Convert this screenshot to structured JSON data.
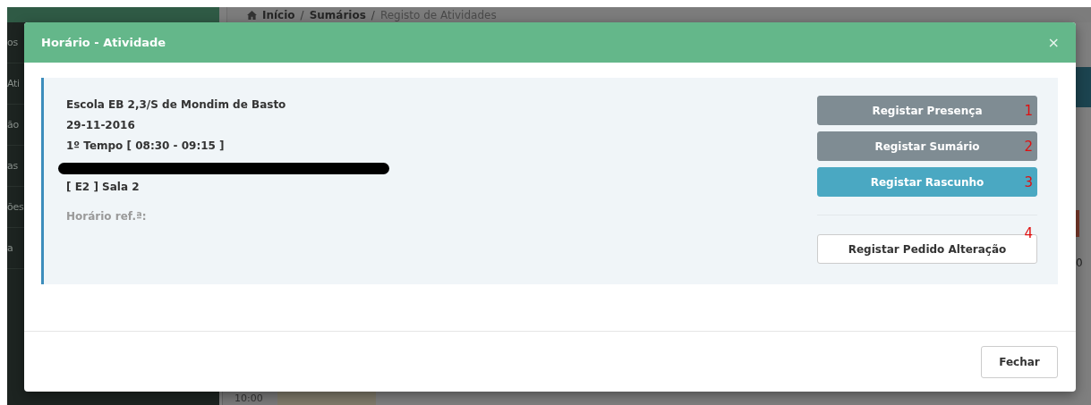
{
  "background": {
    "sidebar_items": [
      "os",
      "Ati",
      "ão",
      "as",
      "ões",
      "a"
    ],
    "breadcrumb": [
      {
        "label": "Início",
        "current": false
      },
      {
        "label": "Sumários",
        "current": false,
        "separator": "/"
      },
      {
        "label": "Registo de Atividades",
        "current": true,
        "separator": "/"
      }
    ],
    "time_cell": "10:00",
    "edge_text": "0"
  },
  "modal": {
    "title": "Horário - Atividade",
    "close": "×",
    "info": [
      {
        "kind": "strong",
        "text": "Escola EB 2,3/S de Mondim de Basto"
      },
      {
        "kind": "strong",
        "text": "29-11-2016"
      },
      {
        "kind": "strong",
        "text": "1º Tempo [ 08:30 - 09:15 ]"
      },
      {
        "kind": "redacted"
      },
      {
        "kind": "strong",
        "text": "[ E2 ] Sala 2"
      },
      {
        "kind": "muted",
        "text": "Horário ref.ª:"
      }
    ],
    "actions": [
      {
        "label": "Registar Presença",
        "kind": "secondary",
        "marker": "1",
        "separated": false
      },
      {
        "label": "Registar Sumário",
        "kind": "secondary",
        "marker": "2",
        "separated": false
      },
      {
        "label": "Registar Rascunho",
        "kind": "info",
        "marker": "3",
        "separated": false
      },
      {
        "label": "Registar Pedido Alteração",
        "kind": "default",
        "marker": "4",
        "separated": true
      }
    ],
    "footer_button": "Fechar"
  }
}
